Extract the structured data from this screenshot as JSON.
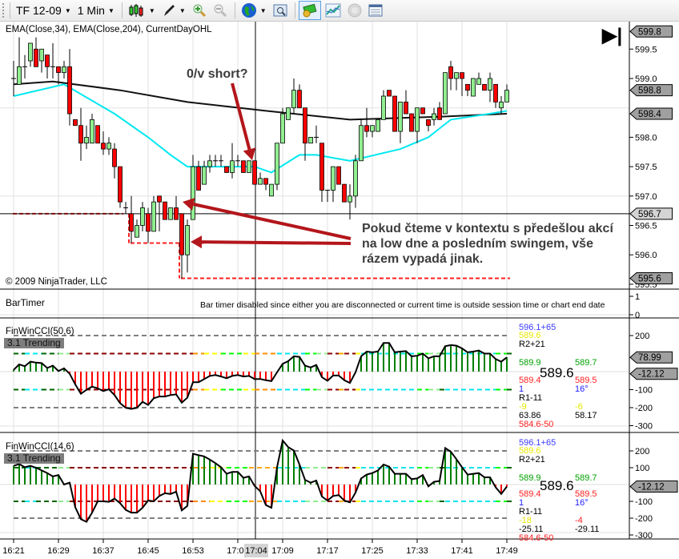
{
  "toolbar": {
    "instrument": "TF 12-09",
    "interval": "1 Min",
    "icons": [
      "candlestick-icon",
      "pencil-icon",
      "zoom-in-icon",
      "zoom-out-icon",
      "globe-icon",
      "properties-icon",
      "chart-trader-icon",
      "strategy-icon",
      "disabled-circle-icon",
      "data-box-icon"
    ]
  },
  "price_panel": {
    "indicators_label": "EMA(Close,34), EMA(Close,204), CurrentDayOHL",
    "copyright": "© 2009 NinjaTrader, LLC",
    "annotation_question": "0/v short?",
    "annotation_lines": [
      "Pokud čteme v kontextu s předešlou akcí",
      "na low dne a posledním swingem, vše",
      "rázem vypadá jinak."
    ],
    "axis_ticks": [
      "599.5",
      "599.0",
      "598.0",
      "597.5",
      "597.0",
      "596.5",
      "596.0",
      "595.5"
    ],
    "markers": [
      {
        "label": "599.8",
        "value": 599.8,
        "color": "#a0a0a0"
      },
      {
        "label": "598.8",
        "value": 598.8,
        "color": "#a0a0a0"
      },
      {
        "label": "598.4",
        "value": 598.4,
        "color": "#a0a0a0"
      },
      {
        "label": "596.7",
        "value": 596.7,
        "color": "#d4d4d4"
      },
      {
        "label": "595.6",
        "value": 595.6,
        "color": "#a0a0a0"
      }
    ],
    "crosshair_price": 596.7
  },
  "bartimer": {
    "label": "BarTimer",
    "message": "Bar timer disabled since either you are disconnected or current time is outside session time or chart end date",
    "axis_ticks": [
      "1",
      "0"
    ]
  },
  "cci_panels": [
    {
      "title": "FinWinCCI(50,6)",
      "state": "3.1 Trending",
      "axis_ticks": [
        "200",
        "-100",
        "-200",
        "-300"
      ],
      "markers": [
        {
          "label": "78.99"
        },
        {
          "label": "-12.12"
        }
      ],
      "info": {
        "r1": "596.1+65",
        "r2": "589.6",
        "r3": "R2+21",
        "a1": "589.9",
        "b1": "589.7",
        "big": "589.6",
        "a2": "589.4",
        "b2": "589.5",
        "a3": "1",
        "b3": "16°",
        "r4": "R1-11",
        "a4": "-9",
        "b4": "-6",
        "a5": "63.86",
        "b5": "58.17",
        "r5": "584.6-50",
        "b4_color": "#e8e800"
      }
    },
    {
      "title": "FinWinCCI(14,6)",
      "state": "3.1 Trending",
      "axis_ticks": [
        "200",
        "100",
        "-100",
        "-200",
        "-300"
      ],
      "markers": [
        {
          "label": "-12.12"
        }
      ],
      "info": {
        "r1": "596.1+65",
        "r2": "589.6",
        "r3": "R2+21",
        "a1": "589.9",
        "b1": "589.7",
        "big": "589.6",
        "a2": "589.4",
        "b2": "589.5",
        "a3": "1",
        "b3": "16°",
        "r4": "R1-11",
        "a4": "-18",
        "b4": "-4",
        "a5": "-25.11",
        "b5": "-29.11",
        "r5": "584.6-50",
        "b4_color": "#ff2020"
      }
    }
  ],
  "time_axis": {
    "labels": [
      "16:21",
      "16:29",
      "16:37",
      "16:45",
      "16:53",
      "17:01",
      "17:09",
      "17:17",
      "17:25",
      "17:33",
      "17:41",
      "17:49"
    ],
    "crosshair_label": "17:04"
  },
  "colors": {
    "up": "#90ee90",
    "down": "#ff0000",
    "ema34": "#00e8f0",
    "ema204": "#111111",
    "arrow": "#b3161b",
    "hist_up": "#008000",
    "hist_down": "#ff0000",
    "dayohl": "#ff2020"
  },
  "chart_data": {
    "type": "candlestick",
    "interval_minutes": 1,
    "start_time": "16:21",
    "ohlc": [
      [
        599.0,
        599.3,
        598.7,
        599.0
      ],
      [
        598.9,
        599.7,
        598.9,
        599.2
      ],
      [
        599.2,
        599.4,
        599.0,
        599.2
      ],
      [
        599.3,
        599.6,
        599.2,
        599.6
      ],
      [
        599.5,
        599.7,
        599.2,
        599.2
      ],
      [
        599.3,
        599.5,
        599.1,
        599.5
      ],
      [
        599.4,
        599.4,
        599.0,
        599.2
      ],
      [
        599.2,
        599.6,
        599.0,
        599.2
      ],
      [
        599.2,
        599.2,
        598.9,
        599.1
      ],
      [
        599.1,
        599.3,
        599.0,
        599.2
      ],
      [
        599.2,
        599.5,
        598.2,
        598.4
      ],
      [
        598.3,
        598.3,
        598.2,
        598.2
      ],
      [
        598.2,
        598.5,
        597.6,
        597.9
      ],
      [
        597.9,
        598.2,
        597.8,
        598.0
      ],
      [
        597.9,
        598.4,
        597.9,
        598.3
      ],
      [
        598.2,
        598.2,
        597.9,
        597.9
      ],
      [
        597.9,
        598.1,
        597.7,
        597.8
      ],
      [
        597.8,
        598.0,
        597.7,
        597.9
      ],
      [
        597.8,
        597.9,
        597.3,
        597.5
      ],
      [
        597.5,
        597.5,
        596.8,
        596.9
      ],
      [
        596.8,
        596.9,
        596.7,
        596.8
      ],
      [
        596.7,
        597.0,
        596.2,
        596.4
      ],
      [
        596.3,
        596.6,
        596.3,
        596.5
      ],
      [
        596.5,
        596.9,
        596.4,
        596.8
      ],
      [
        596.7,
        596.8,
        596.2,
        596.4
      ],
      [
        596.4,
        597.0,
        596.4,
        596.9
      ],
      [
        597.0,
        597.0,
        596.4,
        596.9
      ],
      [
        596.9,
        596.9,
        596.6,
        596.6
      ],
      [
        596.6,
        596.8,
        596.6,
        596.8
      ],
      [
        596.8,
        597.0,
        596.6,
        596.6
      ],
      [
        596.7,
        596.7,
        595.6,
        596.0
      ],
      [
        596.0,
        596.6,
        595.7,
        596.5
      ],
      [
        596.6,
        597.7,
        596.6,
        597.5
      ],
      [
        597.5,
        597.6,
        597.1,
        597.1
      ],
      [
        597.2,
        597.6,
        597.2,
        597.5
      ],
      [
        597.5,
        597.7,
        597.4,
        597.6
      ],
      [
        597.6,
        597.7,
        597.5,
        597.6
      ],
      [
        597.6,
        597.7,
        597.5,
        597.6
      ],
      [
        597.5,
        597.5,
        597.4,
        597.4
      ],
      [
        597.4,
        597.9,
        597.3,
        597.6
      ],
      [
        597.6,
        597.7,
        597.5,
        597.6
      ],
      [
        597.6,
        597.6,
        597.4,
        597.4
      ],
      [
        597.4,
        597.6,
        597.4,
        597.6
      ],
      [
        597.6,
        597.6,
        597.2,
        597.2
      ],
      [
        597.2,
        597.4,
        597.2,
        597.3
      ],
      [
        597.3,
        597.3,
        597.1,
        597.2
      ],
      [
        597.0,
        597.2,
        597.0,
        597.2
      ],
      [
        597.2,
        597.9,
        597.1,
        597.9
      ],
      [
        597.9,
        598.5,
        597.9,
        598.4
      ],
      [
        598.3,
        598.5,
        598.3,
        598.5
      ],
      [
        598.5,
        599.0,
        598.4,
        598.8
      ],
      [
        598.8,
        598.9,
        598.5,
        598.5
      ],
      [
        598.5,
        598.5,
        597.6,
        597.9
      ],
      [
        597.9,
        598.0,
        597.9,
        598.0
      ],
      [
        598.0,
        598.2,
        597.9,
        598.0
      ],
      [
        597.9,
        597.9,
        596.9,
        597.1
      ],
      [
        597.1,
        597.1,
        596.9,
        597.1
      ],
      [
        597.1,
        597.5,
        596.9,
        597.5
      ],
      [
        597.5,
        597.5,
        597.2,
        597.2
      ],
      [
        597.2,
        597.2,
        596.9,
        596.9
      ],
      [
        596.9,
        597.2,
        596.6,
        597.0
      ],
      [
        597.0,
        597.7,
        596.8,
        597.6
      ],
      [
        597.6,
        598.3,
        597.6,
        598.2
      ],
      [
        598.2,
        598.5,
        598.0,
        598.1
      ],
      [
        598.1,
        598.2,
        598.0,
        598.2
      ],
      [
        598.1,
        598.3,
        598.1,
        598.3
      ],
      [
        598.3,
        598.8,
        598.3,
        598.7
      ],
      [
        598.8,
        598.8,
        598.7,
        598.7
      ],
      [
        598.7,
        598.7,
        598.1,
        598.1
      ],
      [
        598.1,
        598.6,
        597.9,
        598.6
      ],
      [
        598.6,
        598.8,
        598.4,
        598.4
      ],
      [
        598.4,
        598.4,
        598.1,
        598.1
      ],
      [
        598.1,
        598.5,
        597.9,
        598.5
      ],
      [
        598.5,
        598.5,
        598.4,
        598.4
      ],
      [
        598.3,
        598.3,
        598.1,
        598.2
      ],
      [
        598.3,
        598.5,
        598.2,
        598.4
      ],
      [
        598.5,
        598.6,
        598.3,
        598.3
      ],
      [
        598.4,
        599.1,
        598.4,
        599.1
      ],
      [
        599.2,
        599.3,
        598.8,
        599.0
      ],
      [
        599.0,
        599.1,
        598.8,
        599.1
      ],
      [
        599.1,
        599.1,
        598.7,
        599.0
      ],
      [
        598.9,
        598.9,
        598.7,
        598.8
      ],
      [
        598.7,
        599.0,
        598.7,
        599.0
      ],
      [
        598.9,
        599.1,
        598.9,
        599.0
      ],
      [
        598.9,
        598.9,
        598.8,
        598.8
      ],
      [
        598.8,
        599.1,
        598.6,
        599.0
      ],
      [
        598.9,
        598.9,
        598.5,
        598.6
      ],
      [
        598.5,
        598.7,
        598.4,
        598.6
      ],
      [
        598.6,
        598.9,
        598.6,
        598.8
      ]
    ],
    "ema34": [
      [
        0,
        598.7
      ],
      [
        9,
        598.9
      ],
      [
        18,
        598.4
      ],
      [
        24,
        598.0
      ],
      [
        28,
        597.7
      ],
      [
        31,
        597.5
      ],
      [
        43,
        597.5
      ],
      [
        46,
        597.4
      ],
      [
        51,
        597.7
      ],
      [
        54,
        597.7
      ],
      [
        60,
        597.6
      ],
      [
        69,
        597.8
      ],
      [
        74,
        598.0
      ],
      [
        78,
        598.3
      ],
      [
        85,
        598.4
      ],
      [
        88,
        598.45
      ]
    ],
    "ema204": [
      [
        0,
        598.9
      ],
      [
        7,
        598.95
      ],
      [
        19,
        598.8
      ],
      [
        31,
        598.6
      ],
      [
        45,
        598.45
      ],
      [
        60,
        598.3
      ],
      [
        76,
        598.35
      ],
      [
        88,
        598.4
      ]
    ],
    "day_low_steps": [
      [
        0,
        20,
        596.7
      ],
      [
        21,
        30,
        596.2
      ],
      [
        30,
        89,
        595.6
      ]
    ],
    "price_range": [
      595.45,
      599.9
    ],
    "cci50": [
      10,
      40,
      30,
      55,
      50,
      47,
      20,
      33,
      3,
      18,
      -12,
      -71,
      -123,
      -101,
      -83,
      -93,
      -108,
      -98,
      -130,
      -175,
      -201,
      -207,
      -201,
      -168,
      -185,
      -148,
      -138,
      -138,
      -130,
      -126,
      -172,
      -145,
      -59,
      -59,
      -42,
      -24,
      -19,
      -27,
      -37,
      -24,
      -19,
      -27,
      -24,
      -42,
      -41,
      -48,
      -53,
      -4,
      43,
      58,
      85,
      82,
      33,
      23,
      37,
      -31,
      -51,
      -22,
      -22,
      -48,
      -63,
      -4,
      85,
      111,
      107,
      111,
      159,
      159,
      107,
      111,
      114,
      85,
      88,
      100,
      74,
      85,
      85,
      141,
      147,
      144,
      129,
      107,
      111,
      117,
      100,
      100,
      70,
      55,
      79
    ],
    "cci14": [
      111,
      122,
      103,
      111,
      100,
      84,
      68,
      48,
      56,
      0,
      11,
      -135,
      -206,
      -222,
      -167,
      -100,
      -100,
      -103,
      -84,
      -111,
      -151,
      -167,
      -167,
      -138,
      -95,
      -100,
      -68,
      -52,
      -56,
      -43,
      -154,
      -127,
      183,
      175,
      167,
      148,
      127,
      103,
      64,
      75,
      75,
      40,
      48,
      -8,
      -40,
      -122,
      -138,
      103,
      262,
      222,
      202,
      119,
      27,
      11,
      24,
      -71,
      -95,
      -68,
      -63,
      -95,
      -106,
      -48,
      36,
      59,
      68,
      84,
      119,
      106,
      64,
      64,
      64,
      32,
      36,
      56,
      -11,
      16,
      21,
      217,
      195,
      151,
      103,
      59,
      64,
      68,
      43,
      43,
      -16,
      -56,
      -12
    ],
    "cci_range": [
      -300,
      250
    ],
    "cci_levels": [
      200,
      100,
      -100,
      -200
    ],
    "zone_colors_cci50": [
      [
        0,
        2,
        "#006400"
      ],
      [
        2,
        5,
        "#00e5ee"
      ],
      [
        5,
        8,
        "#006400"
      ],
      [
        8,
        10,
        "#90ee90"
      ],
      [
        10,
        32,
        "#8b0000"
      ],
      [
        32,
        34,
        "#ff8c00"
      ],
      [
        34,
        37,
        "#ffff00"
      ],
      [
        37,
        41,
        "#00ff00"
      ],
      [
        41,
        43,
        "#ffff00"
      ],
      [
        43,
        47,
        "#ff8c00"
      ],
      [
        47,
        52,
        "#00e5ee"
      ],
      [
        52,
        54,
        "#00ff00"
      ],
      [
        54,
        56,
        "#90ee90"
      ],
      [
        56,
        58,
        "#8b0000"
      ],
      [
        58,
        59,
        "#ffa500"
      ],
      [
        59,
        61,
        "#8b0000"
      ],
      [
        61,
        62,
        "#ffff00"
      ],
      [
        62,
        72,
        "#00e5ee"
      ],
      [
        72,
        74,
        "#00ff00"
      ],
      [
        74,
        76,
        "#90ee90"
      ],
      [
        76,
        77,
        "#006400"
      ],
      [
        77,
        86,
        "#00e5ee"
      ],
      [
        86,
        88,
        "#00ff00"
      ],
      [
        88,
        89,
        "#006400"
      ]
    ],
    "zone_colors_cci14": [
      [
        0,
        2,
        "#006400"
      ],
      [
        2,
        4,
        "#00e5ee"
      ],
      [
        4,
        8,
        "#006400"
      ],
      [
        8,
        10,
        "#90ee90"
      ],
      [
        10,
        32,
        "#8b0000"
      ],
      [
        32,
        35,
        "#ff8c00"
      ],
      [
        35,
        38,
        "#ffff00"
      ],
      [
        38,
        42,
        "#00ff00"
      ],
      [
        42,
        47,
        "#ffa500"
      ],
      [
        47,
        52,
        "#00e5ee"
      ],
      [
        52,
        56,
        "#90ee90"
      ],
      [
        56,
        58,
        "#8b0000"
      ],
      [
        58,
        59,
        "#ffa500"
      ],
      [
        59,
        61,
        "#8b0000"
      ],
      [
        61,
        62,
        "#ffff00"
      ],
      [
        62,
        72,
        "#00e5ee"
      ],
      [
        72,
        74,
        "#00ff00"
      ],
      [
        74,
        76,
        "#90ee90"
      ],
      [
        76,
        77,
        "#006400"
      ],
      [
        77,
        86,
        "#00e5ee"
      ],
      [
        86,
        88,
        "#00ff00"
      ],
      [
        88,
        89,
        "#006400"
      ]
    ]
  }
}
